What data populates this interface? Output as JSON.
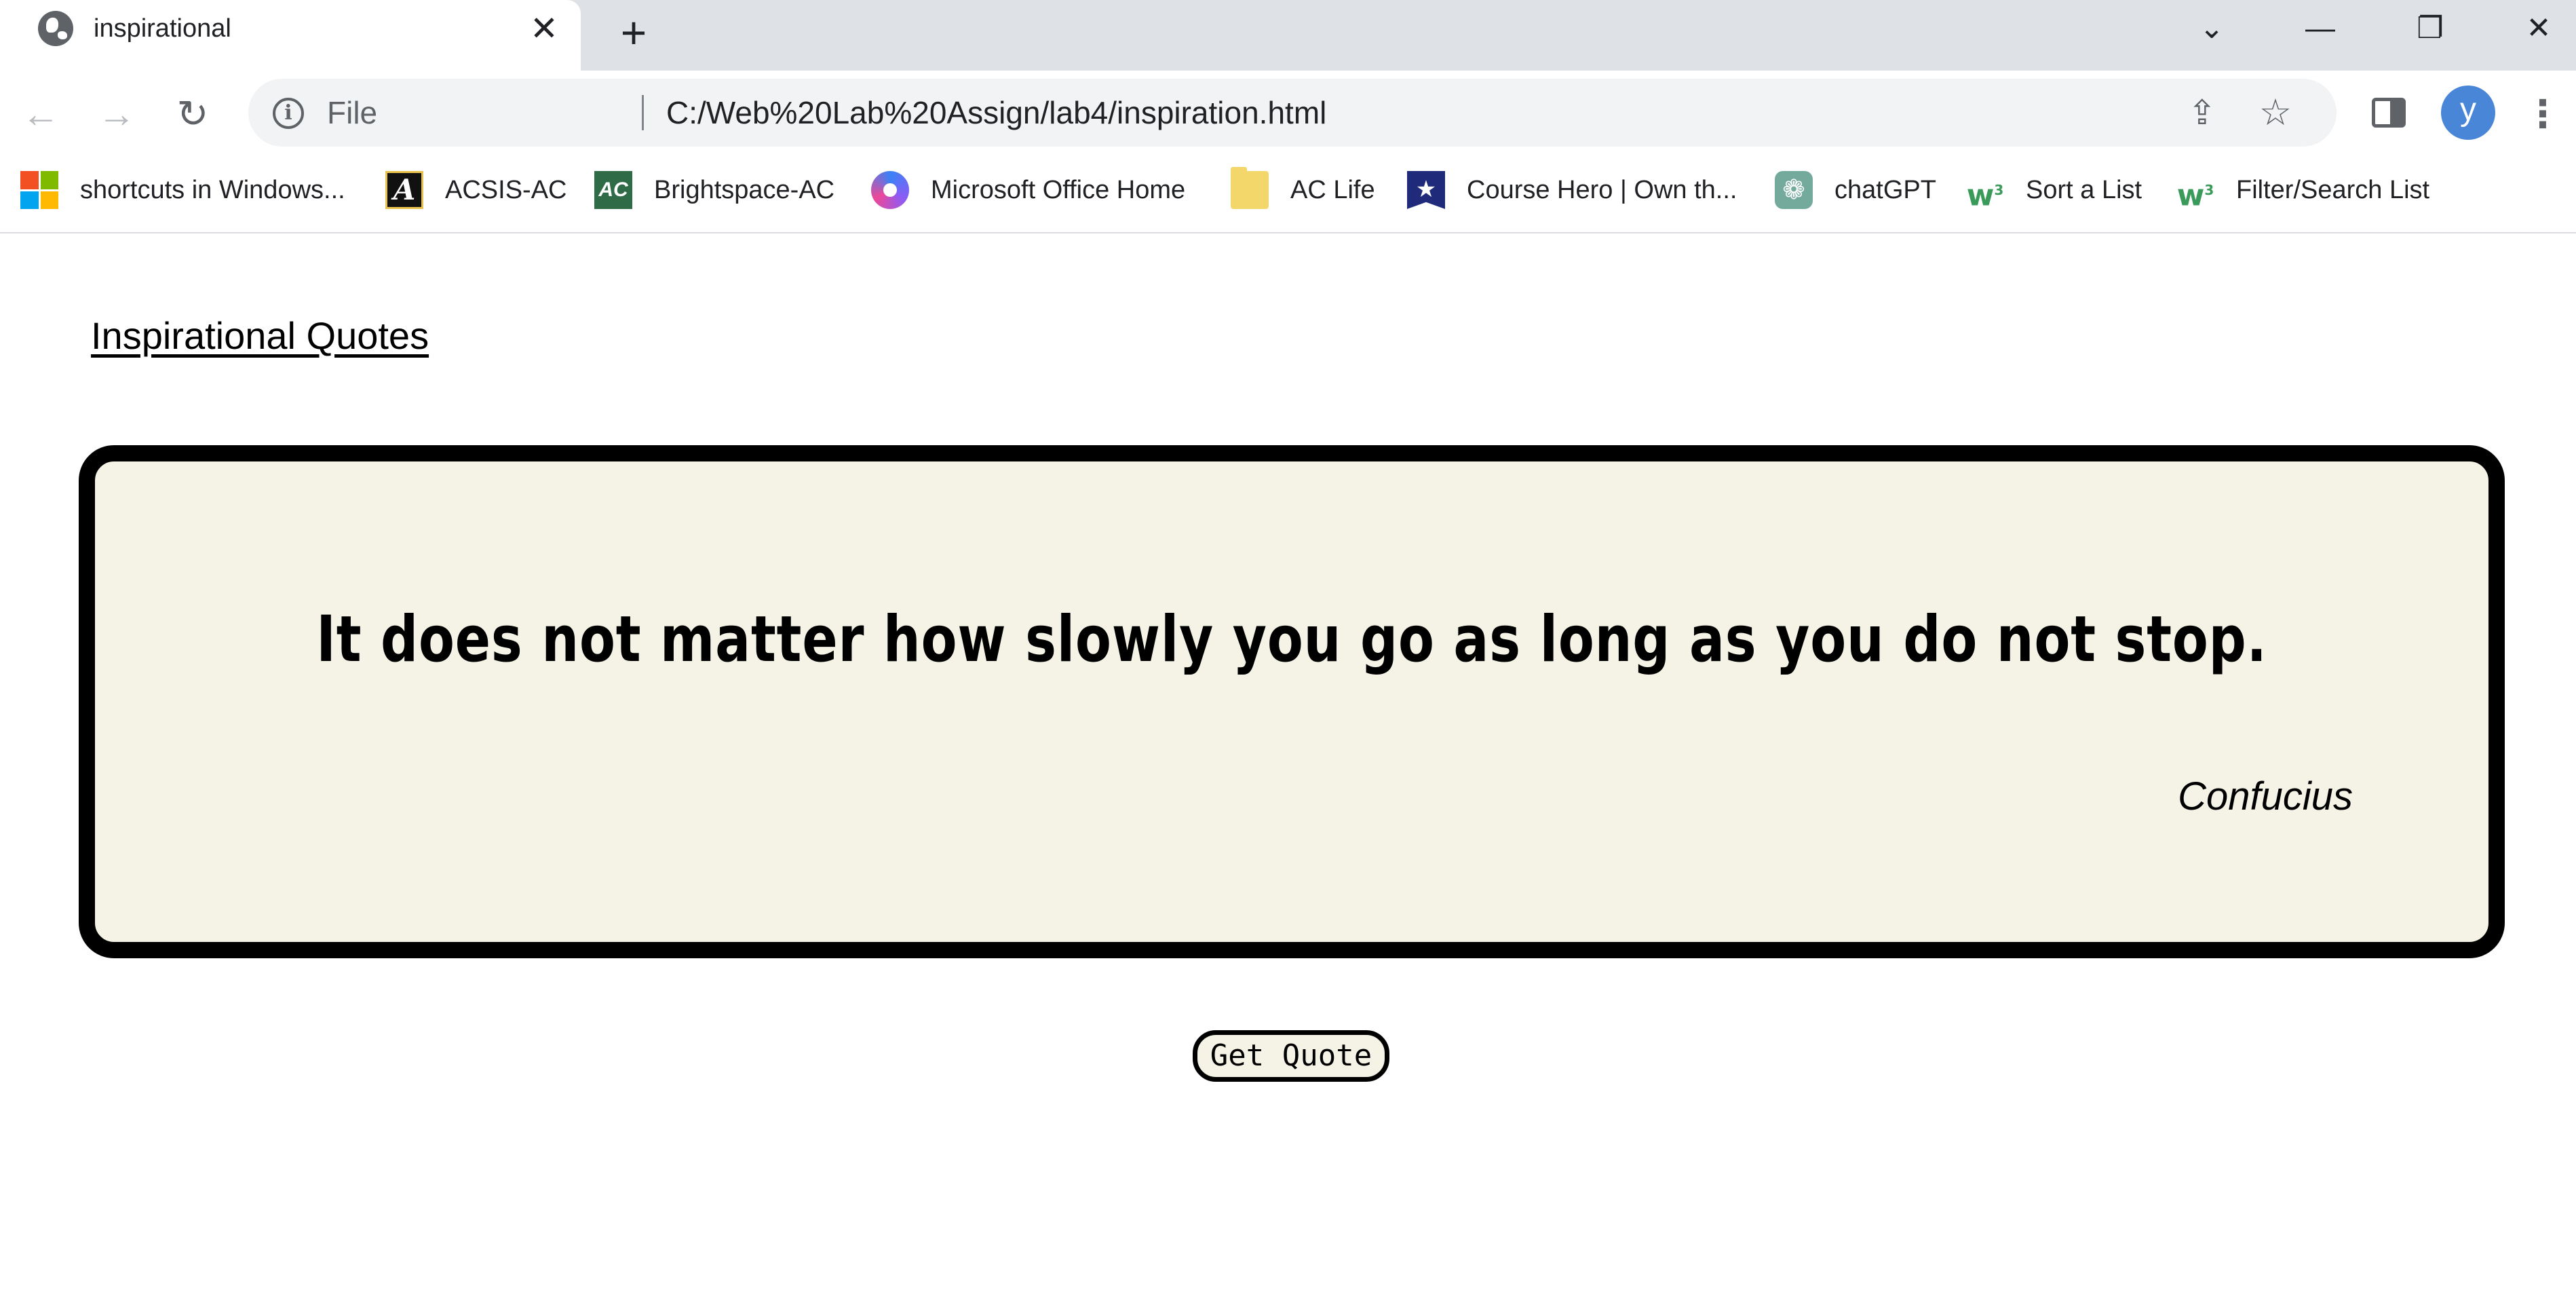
{
  "browser": {
    "tab": {
      "title": "inspirational",
      "favicon": "globe-icon",
      "close_glyph": "✕"
    },
    "new_tab_glyph": "+",
    "window_controls": {
      "tab_search_glyph": "⌄",
      "minimize_glyph": "—",
      "restore_glyph": "❐",
      "close_glyph": "✕"
    },
    "toolbar": {
      "back_glyph": "←",
      "forward_glyph": "→",
      "reload_glyph": "↻",
      "scheme_label": "File",
      "url": "C:/Web%20Lab%20Assign/lab4/inspiration.html",
      "share_glyph": "⇪",
      "bookmark_star_glyph": "☆",
      "profile_initial": "y",
      "menu_glyph": "⋮"
    },
    "bookmarks": [
      {
        "label": "shortcuts in Windows...",
        "icon": "microsoft-logo-icon"
      },
      {
        "label": "ACSIS-AC",
        "icon": "acsis-logo-icon"
      },
      {
        "label": "Brightspace-AC",
        "icon": "brightspace-logo-icon"
      },
      {
        "label": "Microsoft Office Home",
        "icon": "office-logo-icon"
      },
      {
        "label": "AC Life",
        "icon": "folder-icon"
      },
      {
        "label": "Course Hero | Own th...",
        "icon": "coursehero-logo-icon"
      },
      {
        "label": "chatGPT",
        "icon": "chatgpt-logo-icon"
      },
      {
        "label": "Sort a List",
        "icon": "w3schools-logo-icon"
      },
      {
        "label": "Filter/Search List",
        "icon": "w3schools-logo-icon"
      }
    ]
  },
  "page": {
    "heading": "Inspirational Quotes",
    "quote": {
      "text": "It does not matter how slowly you go as long as you do not stop.",
      "author": "Confucius"
    },
    "get_quote_button": "Get Quote"
  },
  "colors": {
    "quote_background": "#f5f3e5",
    "border": "#000000",
    "tabstrip": "#dee1e6",
    "avatar": "#4a86d8"
  }
}
